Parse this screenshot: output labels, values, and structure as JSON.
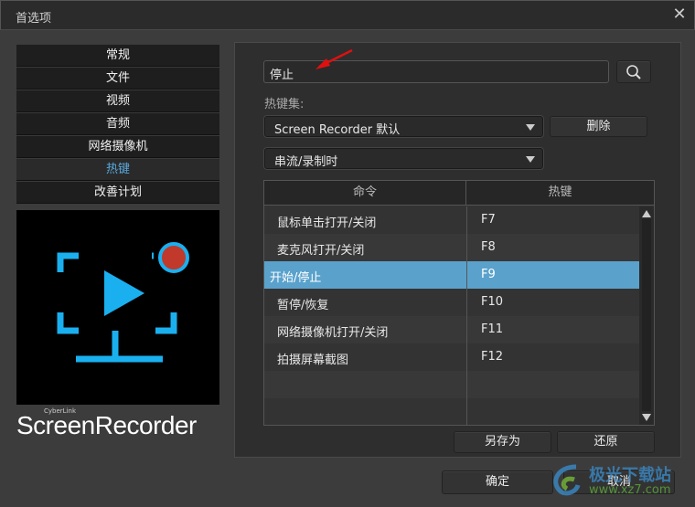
{
  "window": {
    "title": "首选项",
    "close": "✕"
  },
  "nav": {
    "items": [
      {
        "label": "常规"
      },
      {
        "label": "文件"
      },
      {
        "label": "视频"
      },
      {
        "label": "音频"
      },
      {
        "label": "网络摄像机"
      },
      {
        "label": "热键",
        "active": true
      },
      {
        "label": "改善计划"
      }
    ]
  },
  "brand": {
    "company": "CyberLink",
    "product": "ScreenRecorder"
  },
  "search": {
    "value": "停止"
  },
  "hotkey_set": {
    "label": "热键集:",
    "selected": "Screen Recorder 默认",
    "delete": "删除"
  },
  "mode": {
    "selected": "串流/录制时"
  },
  "table": {
    "headers": [
      "命令",
      "热键"
    ],
    "rows": [
      {
        "command": "鼠标单击打开/关闭",
        "key": "F7"
      },
      {
        "command": "麦克风打开/关闭",
        "key": "F8"
      },
      {
        "command": "开始/停止",
        "key": "F9",
        "selected": true
      },
      {
        "command": "暂停/恢复",
        "key": "F10"
      },
      {
        "command": "网络摄像机打开/关闭",
        "key": "F11"
      },
      {
        "command": "拍摄屏幕截图",
        "key": "F12"
      }
    ]
  },
  "actions": {
    "save_as": "另存为",
    "restore": "还原"
  },
  "footer": {
    "ok": "确定",
    "cancel": "取消"
  },
  "watermark": {
    "name": "极光下载站",
    "url": "www.xz7.com"
  },
  "colors": {
    "accent": "#5aa2cc",
    "record": "#c0392b",
    "logo_blue": "#1ab0f0"
  }
}
